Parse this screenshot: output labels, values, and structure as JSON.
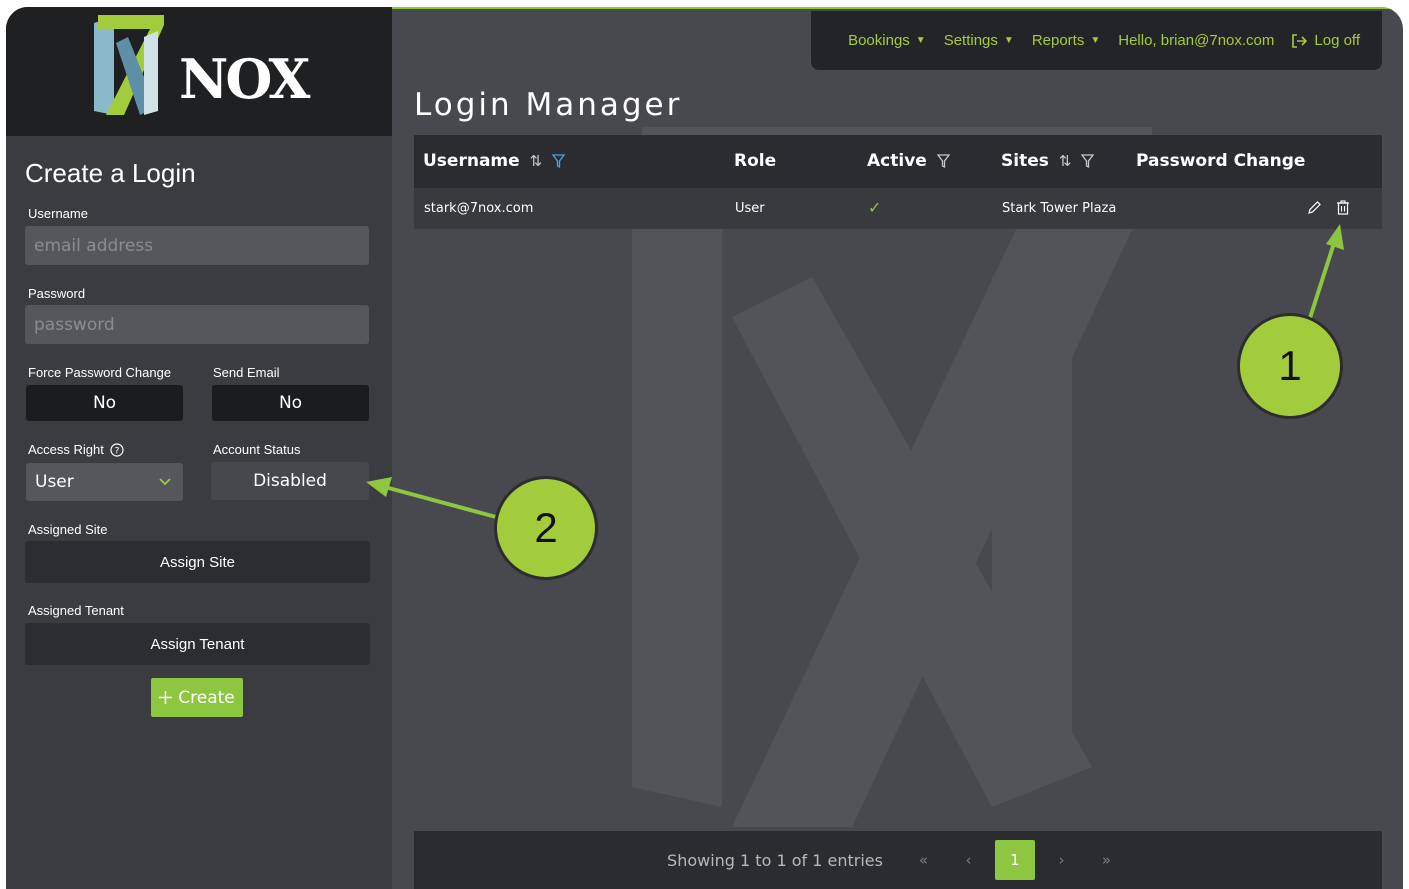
{
  "brand": {
    "name": "NOX"
  },
  "navbar": {
    "bookings": "Bookings",
    "settings": "Settings",
    "reports": "Reports",
    "greeting": "Hello, brian@7nox.com",
    "logoff": "Log off"
  },
  "form": {
    "title": "Create a Login",
    "username_label": "Username",
    "username_placeholder": "email address",
    "password_label": "Password",
    "password_placeholder": "password",
    "force_label": "Force Password Change",
    "force_value": "No",
    "send_label": "Send Email",
    "send_value": "No",
    "access_label": "Access Right",
    "access_value": "User",
    "status_label": "Account Status",
    "status_value": "Disabled",
    "site_label": "Assigned Site",
    "site_button": "Assign Site",
    "tenant_label": "Assigned Tenant",
    "tenant_button": "Assign Tenant",
    "create_button": "Create"
  },
  "main": {
    "title": "Login Manager",
    "columns": [
      "Username",
      "Role",
      "Active",
      "Sites",
      "Password Change"
    ],
    "rows": [
      {
        "username": "stark@7nox.com",
        "role": "User",
        "active": "✓",
        "sites": "Stark Tower Plaza"
      }
    ],
    "footer": {
      "info": "Showing 1 to 1 of 1 entries",
      "current_page": "1"
    }
  },
  "annotations": {
    "one": "1",
    "two": "2"
  },
  "colors": {
    "accent": "#8dc63f",
    "callout": "#a3cc3c",
    "sidebar": "#3a3c40",
    "main": "#47494e"
  }
}
